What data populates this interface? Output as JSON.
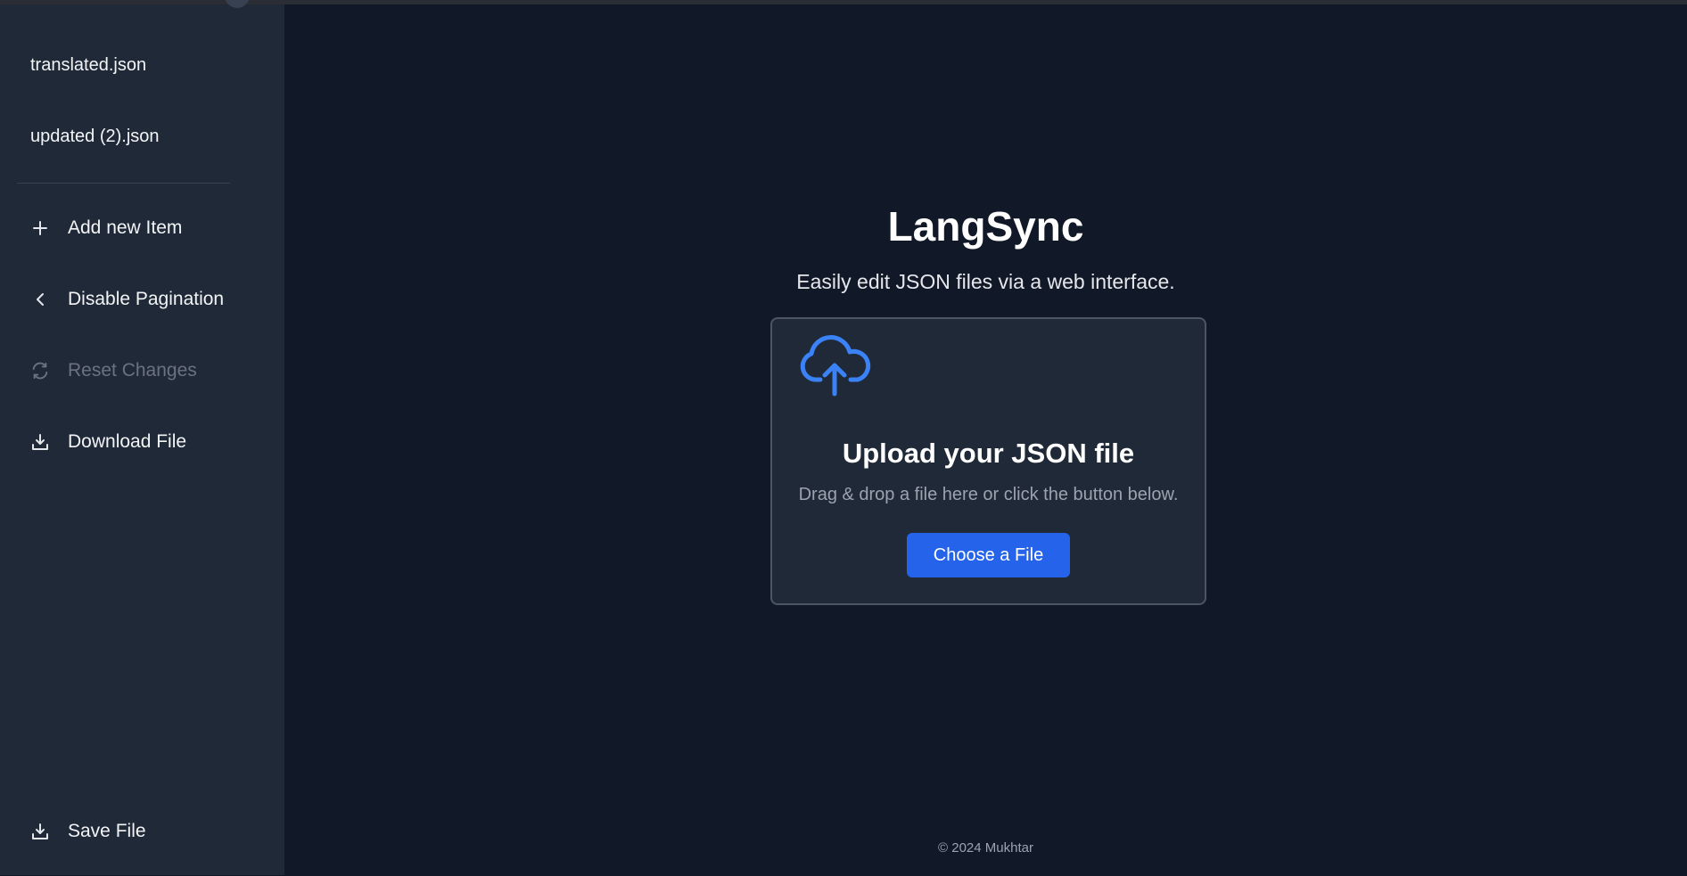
{
  "sidebar": {
    "files": [
      "translated.json",
      "updated (2).json"
    ],
    "actions": {
      "add_new_item": "Add new Item",
      "disable_pagination": "Disable Pagination",
      "reset_changes": "Reset Changes",
      "download_file": "Download File",
      "save_file": "Save File"
    },
    "icons": {
      "add_new_item": "plus-icon",
      "disable_pagination": "chevron-left-icon",
      "reset_changes": "refresh-icon",
      "download_file": "download-icon",
      "save_file": "download-icon"
    }
  },
  "main": {
    "title": "LangSync",
    "subtitle": "Easily edit JSON files via a web interface.",
    "upload": {
      "icon": "cloud-upload-icon",
      "title": "Upload your JSON file",
      "description": "Drag & drop a file here or click the button below.",
      "button_label": "Choose a File"
    },
    "footer": "© 2024 Mukhtar"
  },
  "colors": {
    "background": "#111827",
    "sidebar": "#1f2937",
    "accent": "#2563eb",
    "icon_accent": "#3b82f6",
    "disabled_text": "#6b7280"
  }
}
